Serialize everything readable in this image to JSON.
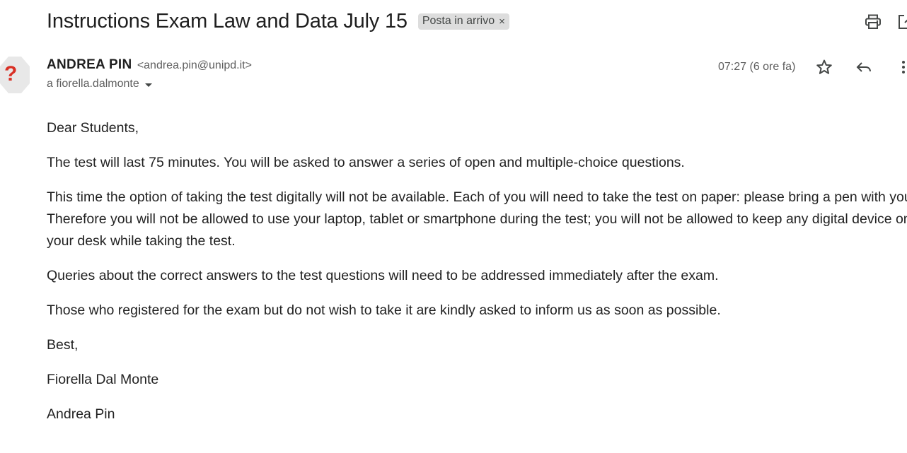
{
  "email": {
    "subject": "Instructions Exam Law and Data July 15",
    "label_chip": "Posta in arrivo",
    "label_chip_close": "×",
    "sender": {
      "name": "ANDREA PIN",
      "email": "<andrea.pin@unipd.it>",
      "avatar_glyph": "?"
    },
    "to_line": "a fiorella.dalmonte",
    "timestamp": "07:27 (6 ore fa)",
    "body": {
      "greeting": "Dear Students,",
      "p1": "The test will last 75 minutes. You will be asked to answer a series of open and multiple-choice questions.",
      "p2": "This time the option of taking the test digitally will not be available. Each of you will need to take the test on paper: please bring a pen with you. Therefore you will not be allowed to use your laptop, tablet or smartphone during the test; you will not be allowed to keep any digital device on your desk while taking the test.",
      "p3": "Queries about the correct answers to the test questions will need to be addressed immediately after the exam.",
      "p4": "Those who registered for the exam but do not wish to take it are kindly asked to inform us as soon as possible.",
      "closing": "Best,",
      "signature_1": "Fiorella Dal Monte",
      "signature_2": "Andrea Pin"
    }
  },
  "icons": {
    "print": "print-icon",
    "open_new_window": "open-in-new-window-icon",
    "star": "star-icon",
    "reply": "reply-icon",
    "more": "more-vert-icon",
    "recipients_dropdown": "chevron-down-icon"
  },
  "colors": {
    "avatar_bg": "#e8e8e8",
    "avatar_glyph": "#d93025",
    "chip_bg": "#dddddd",
    "text": "#222222",
    "muted": "#5e5e5e"
  }
}
